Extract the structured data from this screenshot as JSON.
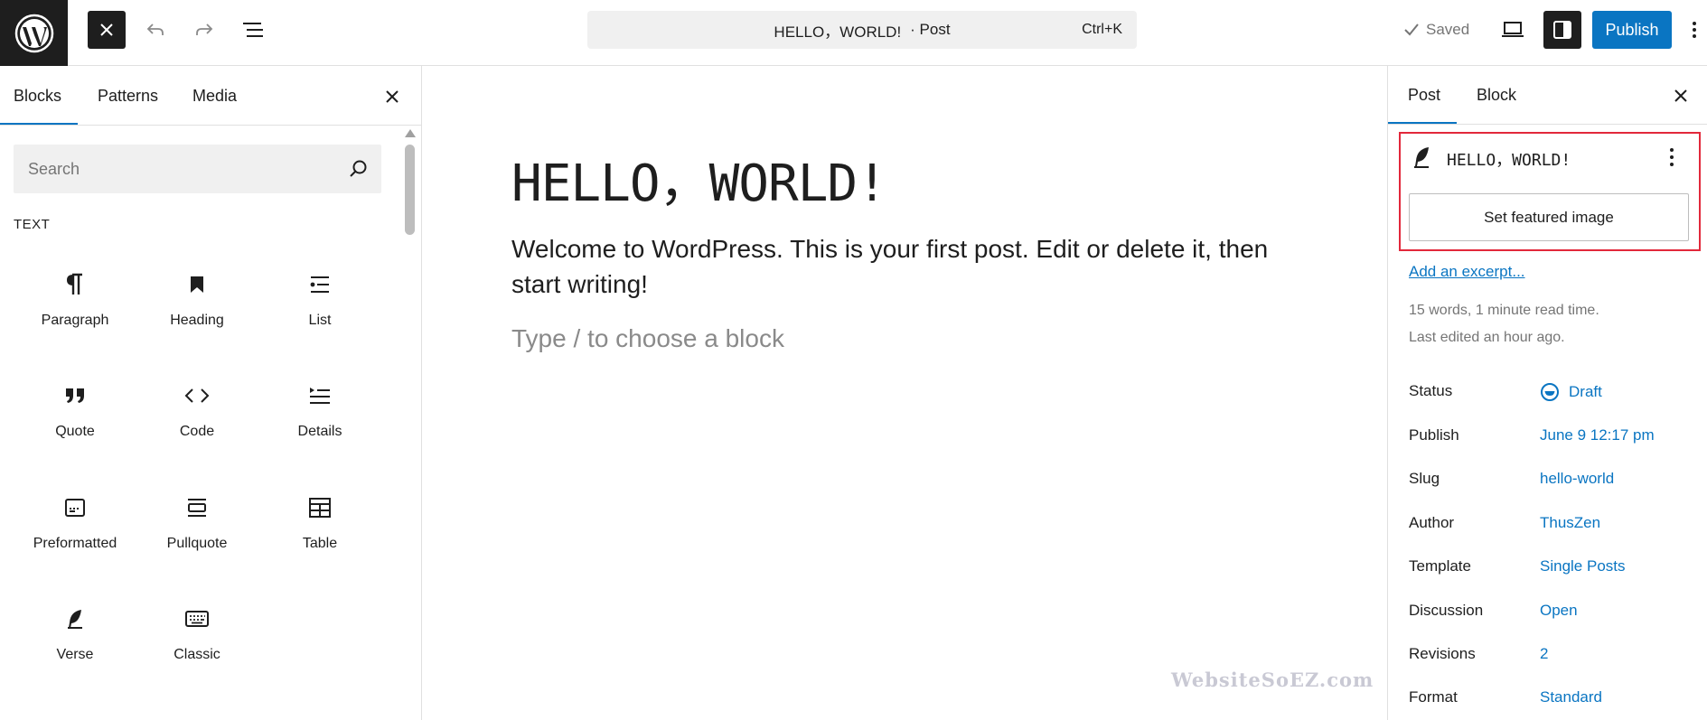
{
  "topbar": {
    "command_title": "HELLO，WORLD!",
    "command_type": "· Post",
    "command_shortcut": "Ctrl+K",
    "saved_label": "Saved",
    "publish_label": "Publish"
  },
  "inserter": {
    "tabs": [
      {
        "label": "Blocks",
        "active": true
      },
      {
        "label": "Patterns",
        "active": false
      },
      {
        "label": "Media",
        "active": false
      }
    ],
    "search_placeholder": "Search",
    "category": "TEXT",
    "blocks": [
      {
        "label": "Paragraph",
        "icon": "paragraph-icon"
      },
      {
        "label": "Heading",
        "icon": "heading-icon"
      },
      {
        "label": "List",
        "icon": "list-icon"
      },
      {
        "label": "Quote",
        "icon": "quote-icon"
      },
      {
        "label": "Code",
        "icon": "code-icon"
      },
      {
        "label": "Details",
        "icon": "details-icon"
      },
      {
        "label": "Preformatted",
        "icon": "preformatted-icon"
      },
      {
        "label": "Pullquote",
        "icon": "pullquote-icon"
      },
      {
        "label": "Table",
        "icon": "table-icon"
      },
      {
        "label": "Verse",
        "icon": "verse-icon"
      },
      {
        "label": "Classic",
        "icon": "classic-icon"
      }
    ]
  },
  "editor": {
    "title": "HELLO，WORLD!",
    "body": "Welcome to WordPress. This is your first post. Edit or delete it, then start writing!",
    "placeholder": "Type / to choose a block",
    "watermark": "WebsiteSoEZ.com"
  },
  "sidebar": {
    "tabs": [
      {
        "label": "Post",
        "active": true
      },
      {
        "label": "Block",
        "active": false
      }
    ],
    "summary_title": "HELLO，WORLD!",
    "featured_image_label": "Set featured image",
    "excerpt_link": "Add an excerpt...",
    "word_count": "15 words, 1 minute read time.",
    "last_edited": "Last edited an hour ago.",
    "meta": [
      {
        "label": "Status",
        "value": "Draft"
      },
      {
        "label": "Publish",
        "value": "June 9 12:17 pm"
      },
      {
        "label": "Slug",
        "value": "hello-world"
      },
      {
        "label": "Author",
        "value": "ThusZen"
      },
      {
        "label": "Template",
        "value": "Single Posts"
      },
      {
        "label": "Discussion",
        "value": "Open"
      },
      {
        "label": "Revisions",
        "value": "2"
      },
      {
        "label": "Format",
        "value": "Standard"
      }
    ]
  },
  "colors": {
    "accent": "#0a75c2",
    "highlight": "#e2283b",
    "dark": "#1e1e1e"
  }
}
